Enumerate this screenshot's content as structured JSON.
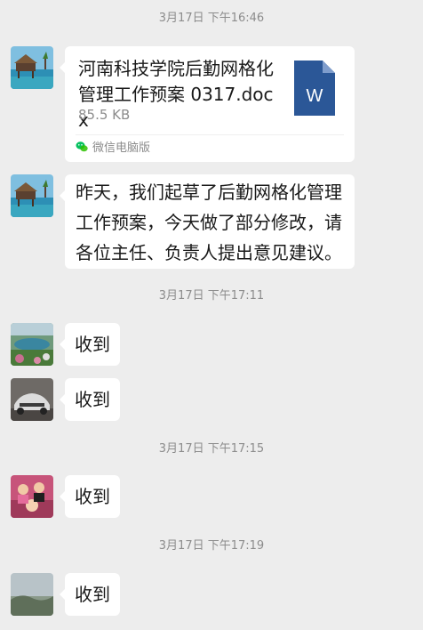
{
  "messages": {
    "ts1": "3月17日 下午16:46",
    "file": {
      "title": "河南科技学院后勤网格化管理工作预案 0317.docx",
      "size": "85.5 KB",
      "icon_letter": "W",
      "icon_color": "#2b5797",
      "source_label": "微信电脑版",
      "source_icon": "wechat-icon"
    },
    "text1": "昨天，我们起草了后勤网格化管理工作预案，今天做了部分修改，请各位主任、负责人提出意见建议。",
    "ts2": "3月17日 下午17:11",
    "reply1": "收到",
    "reply2": "收到",
    "ts3": "3月17日 下午17:15",
    "reply3": "收到",
    "ts4": "3月17日 下午17:19",
    "reply4": "收到"
  },
  "colors": {
    "background": "#ededed",
    "bubble": "#ffffff",
    "wechat_green": "#07c160"
  }
}
